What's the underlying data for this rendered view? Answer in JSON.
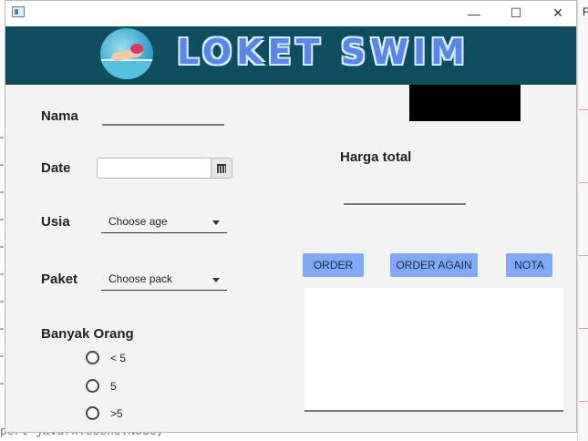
{
  "window": {
    "title_buttons": {
      "minimize": "—",
      "maximize": "☐",
      "close": "✕"
    }
  },
  "banner": {
    "title": "LOKET SWIM"
  },
  "form": {
    "name_label": "Nama",
    "date_label": "Date",
    "date_value": "",
    "age_label": "Usia",
    "age_selected": "Choose age",
    "package_label": "Paket",
    "package_selected": "Choose pack",
    "people_label": "Banyak Orang",
    "people_options": [
      "< 5",
      "5",
      ">5"
    ]
  },
  "summary": {
    "total_label": "Harga total",
    "total_value": ""
  },
  "actions": {
    "order": "ORDER",
    "order_again": "ORDER AGAIN",
    "nota": "NOTA"
  },
  "output": {
    "text": ""
  },
  "background": {
    "right_char": "F",
    "bottom_code": "port javafx.scene.Node;"
  },
  "colors": {
    "banner": "#0e4d5d",
    "title_text": "#5b86e8",
    "button": "#82a9f7",
    "window_bg": "#f3f3f3"
  }
}
